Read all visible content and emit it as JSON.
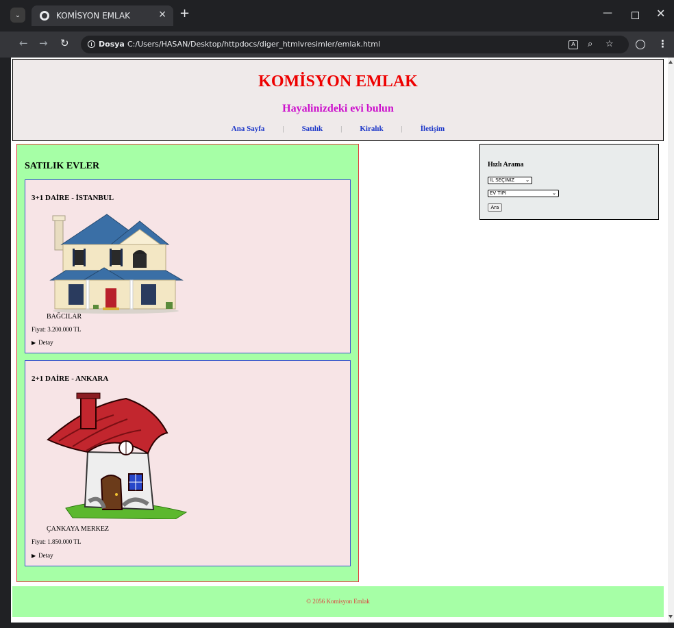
{
  "browser": {
    "tab_title": "KOMİSYON EMLAK",
    "tab_close": "×",
    "new_tab": "+",
    "security_label": "Dosya",
    "url": "C:/Users/HASAN/Desktop/httpdocs/diger_htmlvresimler/emlak.html"
  },
  "header": {
    "title": "KOMİSYON EMLAK",
    "tagline": "Hayalinizdeki evi bulun",
    "nav": [
      {
        "label": "Ana Sayfa"
      },
      {
        "label": "Satılık"
      },
      {
        "label": "Kiralık"
      },
      {
        "label": "İletişim"
      }
    ],
    "separator": "|"
  },
  "main": {
    "section_title": "SATILIK EVLER",
    "listings": [
      {
        "title": "3+1 DAİRE - İSTANBUL",
        "location": "BAĞCILAR",
        "price": "Fiyat: 3.200.000 TL",
        "detail": "Detay",
        "image": "two-story-house"
      },
      {
        "title": "2+1 DAİRE - ANKARA",
        "location": "ÇANKAYA MERKEZ",
        "price": "Fiyat: 1.850.000 TL",
        "detail": "Detay",
        "image": "cartoon-cottage"
      }
    ]
  },
  "sidebar": {
    "title": "Hızlı Arama",
    "city_select": "İL SEÇİNİZ",
    "type_select": "EV TİPİ",
    "search_button": "Ara"
  },
  "footer": {
    "text": "© 2056 Komisyon Emlak"
  },
  "colors": {
    "title_red": "#ee0000",
    "tagline_magenta": "#cc11cc",
    "nav_blue": "#1a35c8",
    "panel_green": "#a6ffa6",
    "listing_pink": "#f7e4e6"
  }
}
